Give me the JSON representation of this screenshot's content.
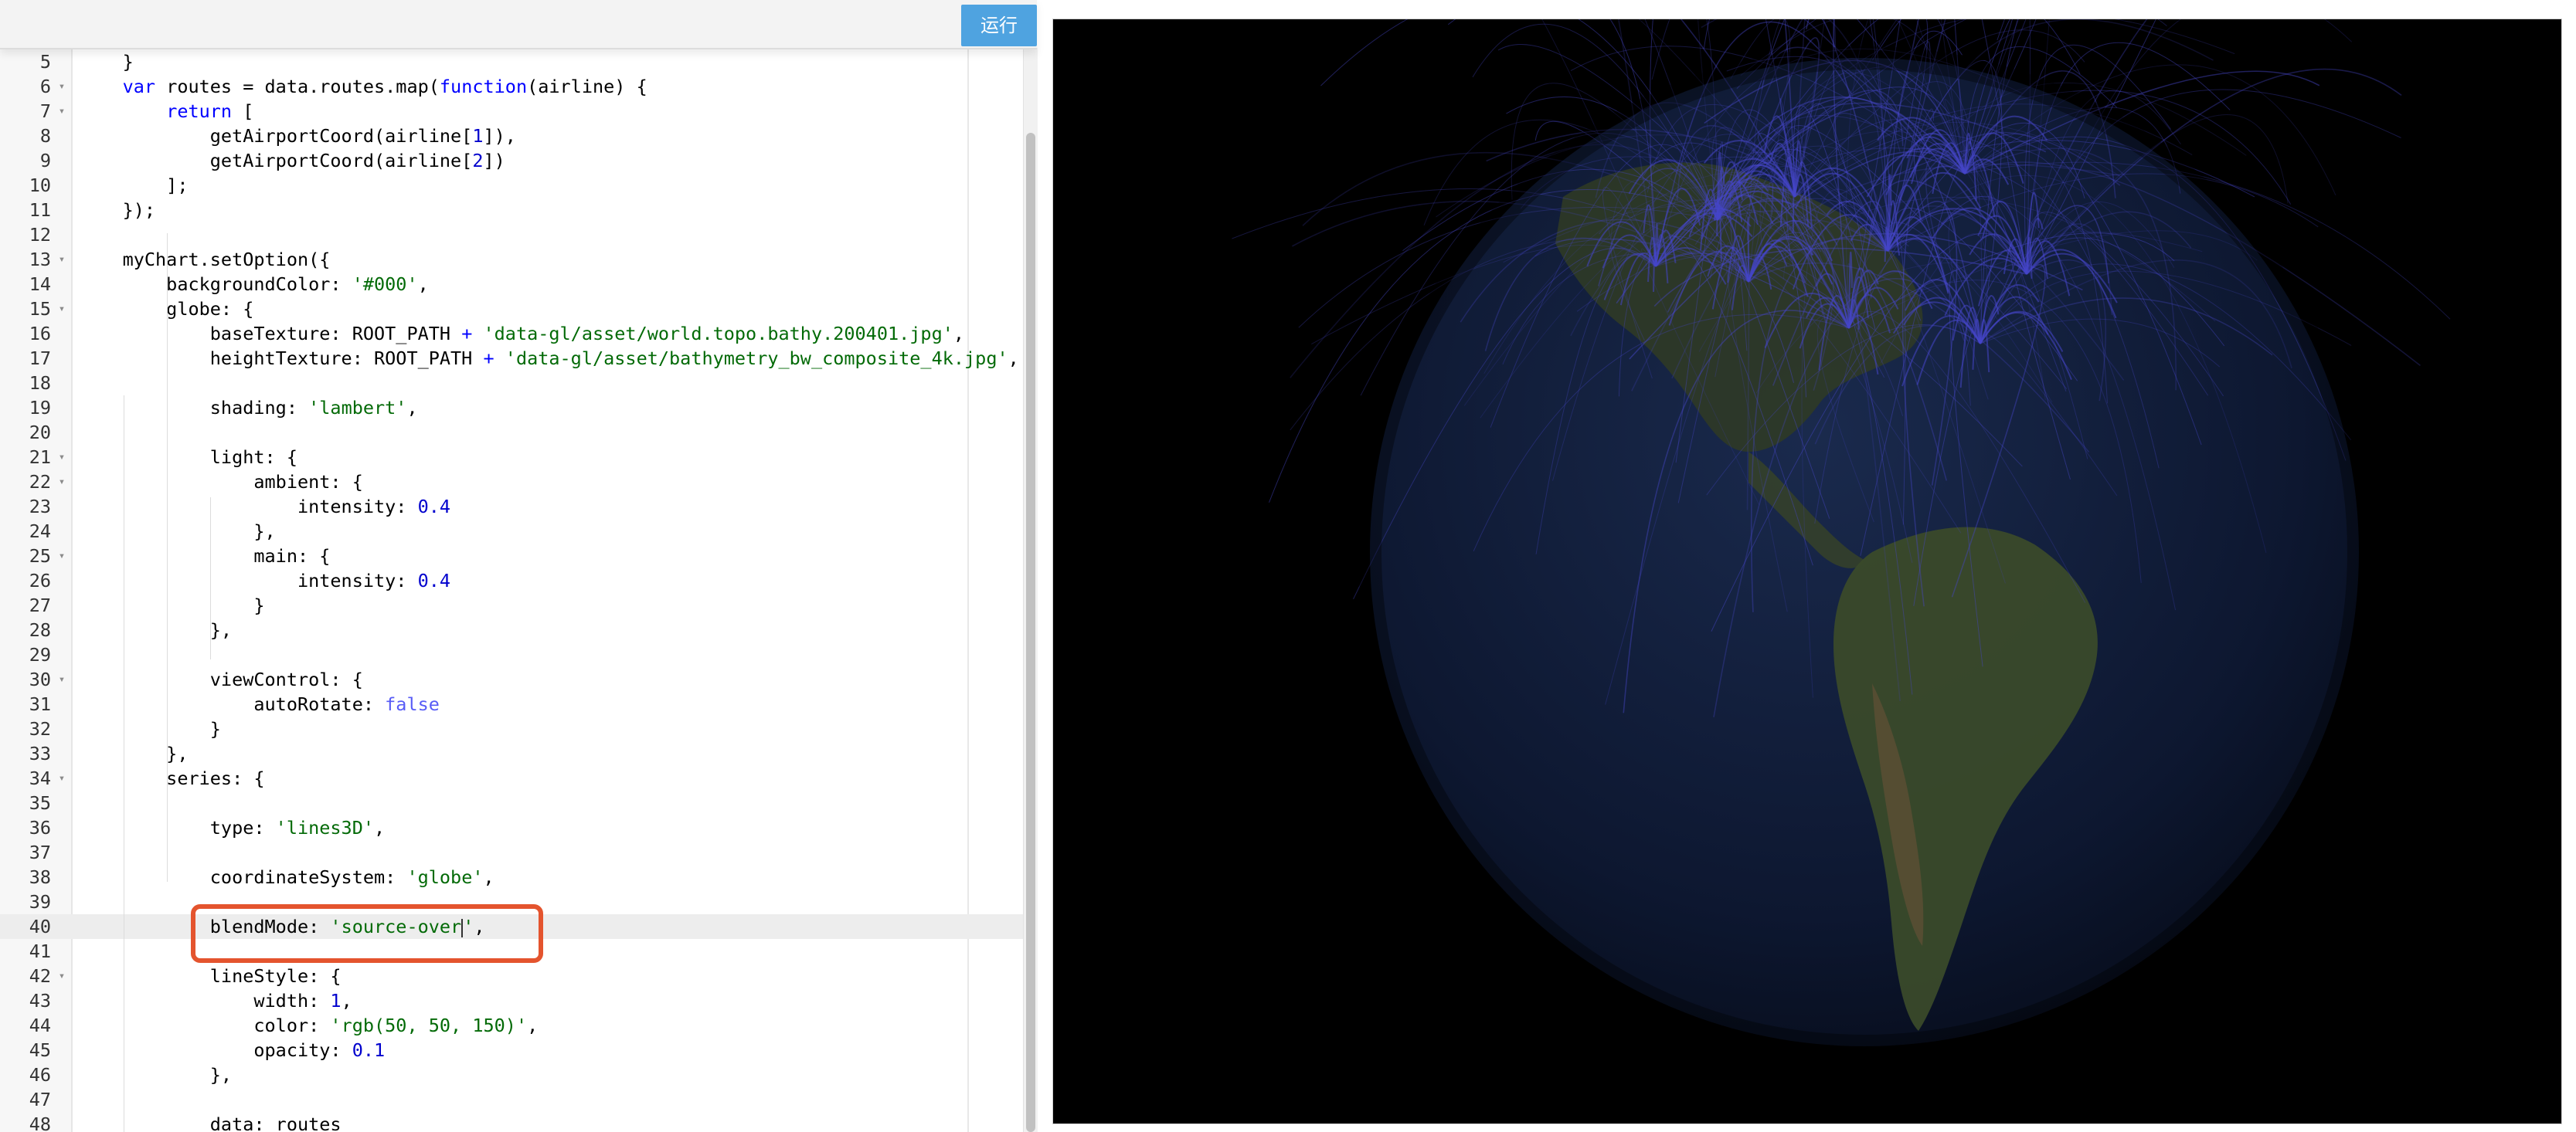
{
  "toolbar": {
    "run_label": "运行"
  },
  "editor": {
    "active_line": 40,
    "fold_marker": "▾",
    "lines": [
      {
        "n": "5",
        "fold": false,
        "tokens": [
          {
            "t": "    }",
            "c": ""
          }
        ]
      },
      {
        "n": "6",
        "fold": true,
        "tokens": [
          {
            "t": "    ",
            "c": ""
          },
          {
            "t": "var",
            "c": "kw"
          },
          {
            "t": " routes = data.routes.map(",
            "c": ""
          },
          {
            "t": "function",
            "c": "kw"
          },
          {
            "t": "(airline) {",
            "c": ""
          }
        ]
      },
      {
        "n": "7",
        "fold": true,
        "tokens": [
          {
            "t": "        ",
            "c": ""
          },
          {
            "t": "return",
            "c": "kw"
          },
          {
            "t": " [",
            "c": ""
          }
        ]
      },
      {
        "n": "8",
        "fold": false,
        "tokens": [
          {
            "t": "            getAirportCoord(airline[",
            "c": ""
          },
          {
            "t": "1",
            "c": "num"
          },
          {
            "t": "]),",
            "c": ""
          }
        ]
      },
      {
        "n": "9",
        "fold": false,
        "tokens": [
          {
            "t": "            getAirportCoord(airline[",
            "c": ""
          },
          {
            "t": "2",
            "c": "num"
          },
          {
            "t": "])",
            "c": ""
          }
        ]
      },
      {
        "n": "10",
        "fold": false,
        "tokens": [
          {
            "t": "        ];",
            "c": ""
          }
        ]
      },
      {
        "n": "11",
        "fold": false,
        "tokens": [
          {
            "t": "    });",
            "c": ""
          }
        ]
      },
      {
        "n": "12",
        "fold": false,
        "tokens": []
      },
      {
        "n": "13",
        "fold": true,
        "tokens": [
          {
            "t": "    myChart.setOption({",
            "c": ""
          }
        ]
      },
      {
        "n": "14",
        "fold": false,
        "tokens": [
          {
            "t": "        backgroundColor: ",
            "c": ""
          },
          {
            "t": "'#000'",
            "c": "str"
          },
          {
            "t": ",",
            "c": ""
          }
        ]
      },
      {
        "n": "15",
        "fold": true,
        "tokens": [
          {
            "t": "        globe: {",
            "c": ""
          }
        ]
      },
      {
        "n": "16",
        "fold": false,
        "tokens": [
          {
            "t": "            baseTexture: ROOT_PATH ",
            "c": ""
          },
          {
            "t": "+",
            "c": "kw"
          },
          {
            "t": " ",
            "c": ""
          },
          {
            "t": "'data-gl/asset/world.topo.bathy.200401.jpg'",
            "c": "str"
          },
          {
            "t": ",",
            "c": ""
          }
        ]
      },
      {
        "n": "17",
        "fold": false,
        "tokens": [
          {
            "t": "            heightTexture: ROOT_PATH ",
            "c": ""
          },
          {
            "t": "+",
            "c": "kw"
          },
          {
            "t": " ",
            "c": ""
          },
          {
            "t": "'data-gl/asset/bathymetry_bw_composite_4k.jpg'",
            "c": "str"
          },
          {
            "t": ",",
            "c": ""
          }
        ]
      },
      {
        "n": "18",
        "fold": false,
        "tokens": []
      },
      {
        "n": "19",
        "fold": false,
        "tokens": [
          {
            "t": "            shading: ",
            "c": ""
          },
          {
            "t": "'lambert'",
            "c": "str"
          },
          {
            "t": ",",
            "c": ""
          }
        ]
      },
      {
        "n": "20",
        "fold": false,
        "tokens": []
      },
      {
        "n": "21",
        "fold": true,
        "tokens": [
          {
            "t": "            light: {",
            "c": ""
          }
        ]
      },
      {
        "n": "22",
        "fold": true,
        "tokens": [
          {
            "t": "                ambient: {",
            "c": ""
          }
        ]
      },
      {
        "n": "23",
        "fold": false,
        "tokens": [
          {
            "t": "                    intensity: ",
            "c": ""
          },
          {
            "t": "0.4",
            "c": "num"
          }
        ]
      },
      {
        "n": "24",
        "fold": false,
        "tokens": [
          {
            "t": "                },",
            "c": ""
          }
        ]
      },
      {
        "n": "25",
        "fold": true,
        "tokens": [
          {
            "t": "                main: {",
            "c": ""
          }
        ]
      },
      {
        "n": "26",
        "fold": false,
        "tokens": [
          {
            "t": "                    intensity: ",
            "c": ""
          },
          {
            "t": "0.4",
            "c": "num"
          }
        ]
      },
      {
        "n": "27",
        "fold": false,
        "tokens": [
          {
            "t": "                }",
            "c": ""
          }
        ]
      },
      {
        "n": "28",
        "fold": false,
        "tokens": [
          {
            "t": "            },",
            "c": ""
          }
        ]
      },
      {
        "n": "29",
        "fold": false,
        "tokens": []
      },
      {
        "n": "30",
        "fold": true,
        "tokens": [
          {
            "t": "            viewControl: {",
            "c": ""
          }
        ]
      },
      {
        "n": "31",
        "fold": false,
        "tokens": [
          {
            "t": "                autoRotate: ",
            "c": ""
          },
          {
            "t": "false",
            "c": "bool"
          }
        ]
      },
      {
        "n": "32",
        "fold": false,
        "tokens": [
          {
            "t": "            }",
            "c": ""
          }
        ]
      },
      {
        "n": "33",
        "fold": false,
        "tokens": [
          {
            "t": "        },",
            "c": ""
          }
        ]
      },
      {
        "n": "34",
        "fold": true,
        "tokens": [
          {
            "t": "        series: {",
            "c": ""
          }
        ]
      },
      {
        "n": "35",
        "fold": false,
        "tokens": []
      },
      {
        "n": "36",
        "fold": false,
        "tokens": [
          {
            "t": "            type: ",
            "c": ""
          },
          {
            "t": "'lines3D'",
            "c": "str"
          },
          {
            "t": ",",
            "c": ""
          }
        ]
      },
      {
        "n": "37",
        "fold": false,
        "tokens": []
      },
      {
        "n": "38",
        "fold": false,
        "tokens": [
          {
            "t": "            coordinateSystem: ",
            "c": ""
          },
          {
            "t": "'globe'",
            "c": "str"
          },
          {
            "t": ",",
            "c": ""
          }
        ]
      },
      {
        "n": "39",
        "fold": false,
        "tokens": []
      },
      {
        "n": "40",
        "fold": false,
        "tokens": [
          {
            "t": "            blendMode: ",
            "c": ""
          },
          {
            "t": "'source-over",
            "c": "str"
          },
          {
            "t": "|",
            "c": "cursor"
          },
          {
            "t": "'",
            "c": "str"
          },
          {
            "t": ",",
            "c": ""
          }
        ]
      },
      {
        "n": "41",
        "fold": false,
        "tokens": []
      },
      {
        "n": "42",
        "fold": true,
        "tokens": [
          {
            "t": "            lineStyle: {",
            "c": ""
          }
        ]
      },
      {
        "n": "43",
        "fold": false,
        "tokens": [
          {
            "t": "                width: ",
            "c": ""
          },
          {
            "t": "1",
            "c": "num"
          },
          {
            "t": ",",
            "c": ""
          }
        ]
      },
      {
        "n": "44",
        "fold": false,
        "tokens": [
          {
            "t": "                color: ",
            "c": ""
          },
          {
            "t": "'rgb(50, 50, 150)'",
            "c": "str"
          },
          {
            "t": ",",
            "c": ""
          }
        ]
      },
      {
        "n": "45",
        "fold": false,
        "tokens": [
          {
            "t": "                opacity: ",
            "c": ""
          },
          {
            "t": "0.1",
            "c": "num"
          }
        ]
      },
      {
        "n": "46",
        "fold": false,
        "tokens": [
          {
            "t": "            },",
            "c": ""
          }
        ]
      },
      {
        "n": "47",
        "fold": false,
        "tokens": []
      },
      {
        "n": "48",
        "fold": false,
        "tokens": [
          {
            "t": "            data: routes",
            "c": ""
          }
        ]
      }
    ]
  },
  "preview": {
    "background": "#000000",
    "globe_ocean": "#0f1a33",
    "route_color": "#4646c8",
    "land_color": "#3c4a2c",
    "desert_color": "#6b5a3e"
  },
  "highlight": {
    "color": "#e4542e",
    "target_line": 40
  }
}
